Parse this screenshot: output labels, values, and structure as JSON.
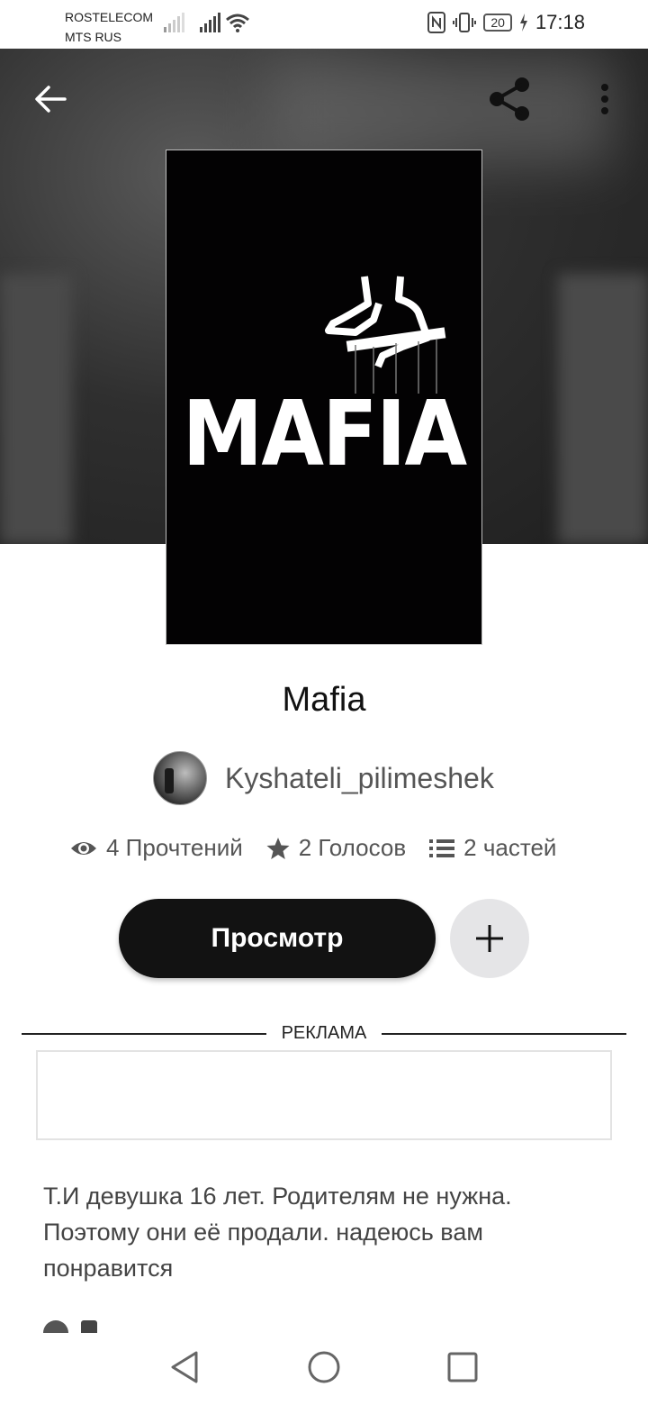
{
  "status_bar": {
    "carrier_1": "ROSTELECOM",
    "carrier_2": "MTS RUS",
    "battery": "20",
    "time": "17:18",
    "icons": [
      "signal-icon",
      "wifi-icon",
      "nfc-icon",
      "vibrate-icon",
      "battery-icon",
      "charging-icon"
    ]
  },
  "toolbar": {
    "back_icon": "arrow-left-icon",
    "share_icon": "share-icon",
    "more_icon": "more-vertical-icon"
  },
  "cover": {
    "title": "MAFIA"
  },
  "story": {
    "title": "Mafia",
    "author": "Kyshateli_pilimeshek"
  },
  "stats": {
    "reads": "4 Прочтений",
    "votes": "2 Голосов",
    "parts": "2 частей"
  },
  "actions": {
    "read_label": "Просмотр",
    "add_icon": "plus-icon"
  },
  "ad": {
    "label": "РЕКЛАМА"
  },
  "description": {
    "text": "Т.И девушка 16 лет. Родителям не нужна. Поэтому они её продали. надеюсь вам понравится"
  },
  "nav": {
    "icons": [
      "nav-back-icon",
      "nav-home-icon",
      "nav-recent-icon"
    ]
  },
  "colors": {
    "primary_button": "#121212",
    "secondary_button": "#e5e5e7",
    "text_muted": "#555555"
  }
}
